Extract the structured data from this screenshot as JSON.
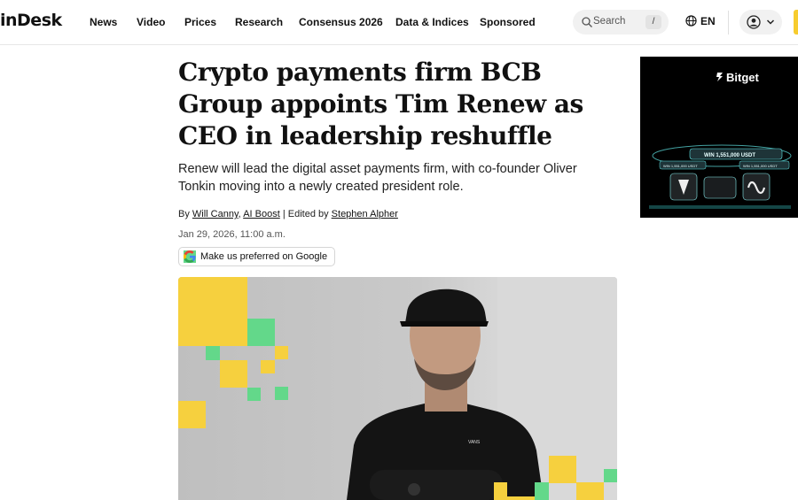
{
  "header": {
    "logo": "inDesk",
    "nav": [
      "News",
      "Video",
      "Prices",
      "Research",
      "Consensus 2026",
      "Data & Indices",
      "Sponsored"
    ],
    "search_placeholder": "Search",
    "search_shortcut": "/",
    "language": "EN"
  },
  "article": {
    "headline": "Crypto payments firm BCB Group appoints Tim Renew as CEO in leadership reshuffle",
    "subhead": "Renew will lead the digital asset payments firm, with co-founder Oliver Tonkin moving into a newly created president role.",
    "byline": {
      "by": "By",
      "author1": "Will Canny",
      "sep": ",",
      "author2": "AI Boost",
      "edited": "| Edited by",
      "editor": "Stephen Alpher"
    },
    "date": "Jan 29, 2026, 11:00 a.m.",
    "google_button": "Make us preferred on Google",
    "hero_shirt_logo": "VANS"
  },
  "ad": {
    "brand": "Bitget",
    "banner1": "WIN 1,551,000 USDT",
    "banner2": "WIN 1,551,000 USDT",
    "banner3": "WIN 1,551,000 USDT"
  },
  "colors": {
    "accent_yellow": "#f6d03e",
    "accent_green": "#63d88a"
  }
}
